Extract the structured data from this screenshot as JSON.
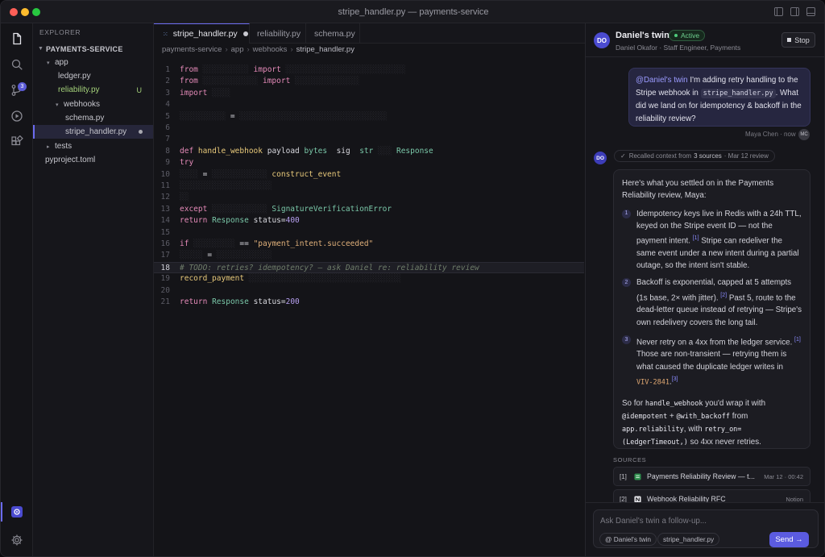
{
  "window": {
    "title": "stripe_handler.py — payments-service"
  },
  "explorer": {
    "header": "EXPLORER",
    "root": "PAYMENTS-SERVICE",
    "items": [
      {
        "label": "app",
        "kind": "folder"
      },
      {
        "label": "ledger.py",
        "kind": "file"
      },
      {
        "label": "reliability.py",
        "kind": "file",
        "status": "U"
      },
      {
        "label": "webhooks",
        "kind": "folder"
      },
      {
        "label": "schema.py",
        "kind": "file"
      },
      {
        "label": "stripe_handler.py",
        "kind": "file",
        "selected": true
      },
      {
        "label": "tests",
        "kind": "folder"
      },
      {
        "label": "pyproject.toml",
        "kind": "file"
      }
    ]
  },
  "activity": {
    "scm_badge": "3"
  },
  "tabs": [
    {
      "label": "stripe_handler.py",
      "active": true,
      "icon": "py"
    },
    {
      "label": "reliability.py"
    },
    {
      "label": "schema.py"
    }
  ],
  "breadcrumb": [
    "payments-service",
    "app",
    "webhooks",
    "stripe_handler.py"
  ],
  "code": {
    "line_numbers": [
      "1",
      "2",
      "3",
      "4",
      "5",
      "6",
      "7",
      "8",
      "9",
      "10",
      "11",
      "12",
      "13",
      "14",
      "15",
      "16",
      "17",
      "18",
      "19",
      "20",
      "21"
    ],
    "tokens": {
      "l1_kw": "from",
      "l1_kw2": "import",
      "l2_kw": "from",
      "l2_kw2": "import",
      "l3_kw": "import",
      "l5_eq": "=",
      "l8_def": "def",
      "l8_fn": "handle_webhook",
      "l8_arg": "payload",
      "l8_t1": "bytes",
      "l8_arg2": "sig",
      "l8_t2": "str",
      "l8_ret": "Response",
      "l9_kw": "try",
      "l10_eq": "=",
      "l10_fn": "construct_event",
      "l13_kw": "except",
      "l13_ty": "SignatureVerificationError",
      "l14_kw": "return",
      "l14_ty": "Response",
      "l14_arg": "status=",
      "l14_num": "400",
      "l16_kw": "if",
      "l16_op": "==",
      "l16_str": "\"payment_intent.succeeded\"",
      "l17_eq": "=",
      "l18_comment": "# TODO: retries? idempotency? — ask Daniel re: reliability review",
      "l19_fn": "record_payment",
      "l21_kw": "return",
      "l21_ty": "Response",
      "l21_arg": "status=",
      "l21_num": "200"
    }
  },
  "panel": {
    "avatar": "DO",
    "name": "Daniel's twin",
    "status": "Active",
    "subtitle": "Daniel Okafor · Staff Engineer, Payments",
    "stop_label": "Stop",
    "user_message": {
      "mention": "@Daniel's twin",
      "text1": " I'm adding retry handling to the Stripe webhook in ",
      "code": "stripe_handler.py",
      "text2": ". What did we land on for idempotency & backoff in the reliability review?",
      "author": "Maya Chen · now",
      "author_initials": "MC"
    },
    "recall": {
      "prefix": "Recalled context from",
      "count": "3 sources",
      "suffix": "· Mar 12 review"
    },
    "answer": {
      "intro": "Here's what you settled on in the Payments Reliability review, Maya:",
      "items": [
        {
          "n": "1",
          "a": "Idempotency keys live in Redis with a 24h TTL, keyed on the Stripe event ID — not the payment intent.",
          "ref1": "[1]",
          "b": " Stripe can redeliver the same event under a new intent during a partial outage, so the intent isn't stable."
        },
        {
          "n": "2",
          "a": "Backoff is exponential, capped at 5 attempts (1s base, 2× with jitter).",
          "ref1": "[2]",
          "b": " Past 5, route to the dead-letter queue instead of retrying — Stripe's own redelivery covers the long tail."
        },
        {
          "n": "3",
          "a": "Never retry on a 4xx from the ledger service.",
          "ref1": "[1]",
          "b": " Those are non-transient — retrying them is what caused the duplicate ledger writes in ",
          "code": "VIV-2841",
          "ref2": "[3]"
        }
      ],
      "outro_pre": "So for ",
      "outro_code1": "handle_webhook",
      "outro_mid1": " you'd wrap it with ",
      "outro_code2": "@idempotent",
      "outro_mid2": " + ",
      "outro_code3": "@with_backoff",
      "outro_mid3": " from ",
      "outro_code4": "app.reliability",
      "outro_mid4": ", with ",
      "outro_code5": "retry_on=(LedgerTimeout,)",
      "outro_end": " so 4xx never retries."
    },
    "sources_header": "SOURCES",
    "sources": [
      {
        "idx": "[1]",
        "title": "Payments Reliability Review — t...",
        "meta": "Mar 12 · 00:42",
        "icon": "doc-icon"
      },
      {
        "idx": "[2]",
        "title": "Webhook Reliability RFC",
        "meta": "Notion",
        "icon": "notion-icon"
      }
    ],
    "input": {
      "placeholder": "Ask Daniel's twin a follow-up...",
      "chip1": "@ Daniel's twin",
      "chip2": "stripe_handler.py",
      "send": "Send →"
    }
  }
}
